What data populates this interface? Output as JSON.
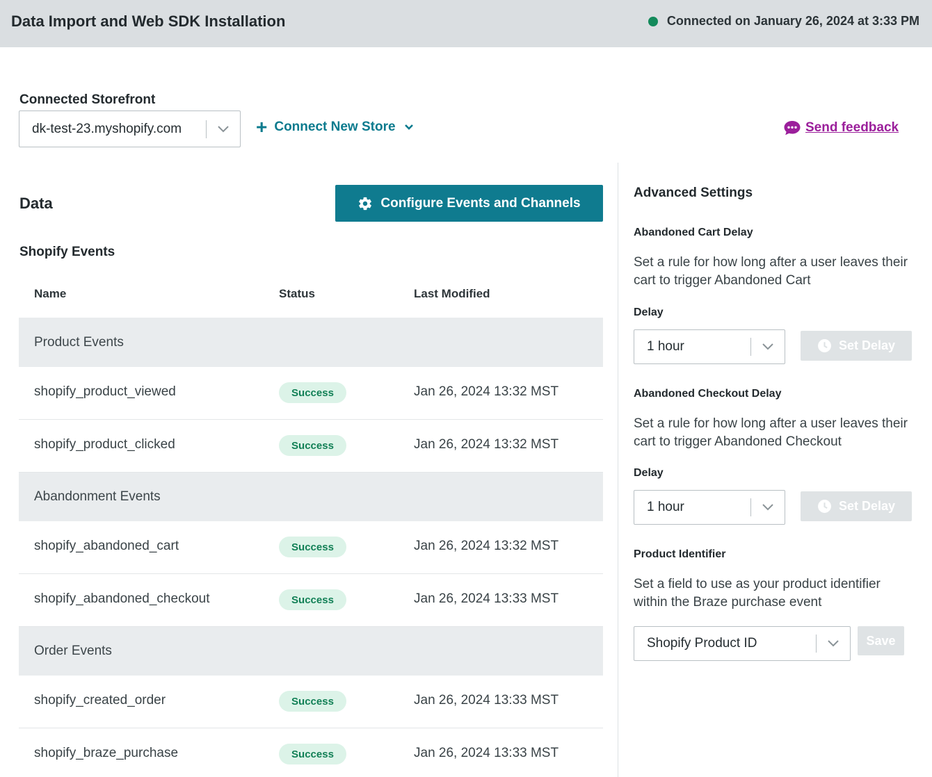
{
  "header": {
    "title": "Data Import and Web SDK Installation",
    "connection_status": "Connected on January 26, 2024 at 3:33 PM",
    "status_color": "#138a5b"
  },
  "storefront": {
    "label": "Connected Storefront",
    "selected": "dk-test-23.myshopify.com",
    "connect_new_label": "Connect New Store",
    "feedback_label": "Send feedback"
  },
  "data_section": {
    "title": "Data",
    "configure_button": "Configure Events and Channels",
    "events_title": "Shopify Events",
    "columns": [
      "Name",
      "Status",
      "Last Modified"
    ],
    "groups": [
      {
        "name": "Product Events",
        "rows": [
          {
            "name": "shopify_product_viewed",
            "status": "Success",
            "modified": "Jan 26, 2024 13:32 MST"
          },
          {
            "name": "shopify_product_clicked",
            "status": "Success",
            "modified": "Jan 26, 2024 13:32 MST"
          }
        ]
      },
      {
        "name": "Abandonment Events",
        "rows": [
          {
            "name": "shopify_abandoned_cart",
            "status": "Success",
            "modified": "Jan 26, 2024 13:32 MST"
          },
          {
            "name": "shopify_abandoned_checkout",
            "status": "Success",
            "modified": "Jan 26, 2024 13:33 MST"
          }
        ]
      },
      {
        "name": "Order Events",
        "rows": [
          {
            "name": "shopify_created_order",
            "status": "Success",
            "modified": "Jan 26, 2024 13:33 MST"
          },
          {
            "name": "shopify_braze_purchase",
            "status": "Success",
            "modified": "Jan 26, 2024 13:33 MST"
          }
        ]
      }
    ]
  },
  "advanced": {
    "title": "Advanced Settings",
    "cart": {
      "title": "Abandoned Cart Delay",
      "description": "Set a rule for how long after a user leaves their cart to trigger Abandoned Cart",
      "delay_label": "Delay",
      "delay_value": "1 hour",
      "button": "Set Delay"
    },
    "checkout": {
      "title": "Abandoned Checkout Delay",
      "description": "Set a rule for how long after a user leaves their cart to trigger Abandoned Checkout",
      "delay_label": "Delay",
      "delay_value": "1 hour",
      "button": "Set Delay"
    },
    "product": {
      "title": "Product Identifier",
      "description": "Set a field to use as your product identifier within the Braze purchase event",
      "value": "Shopify Product ID",
      "button": "Save"
    }
  },
  "colors": {
    "primary": "#0f7b8f",
    "success_bg": "#dcf3e8",
    "success_text": "#128056",
    "feedback": "#9b1f9b"
  }
}
